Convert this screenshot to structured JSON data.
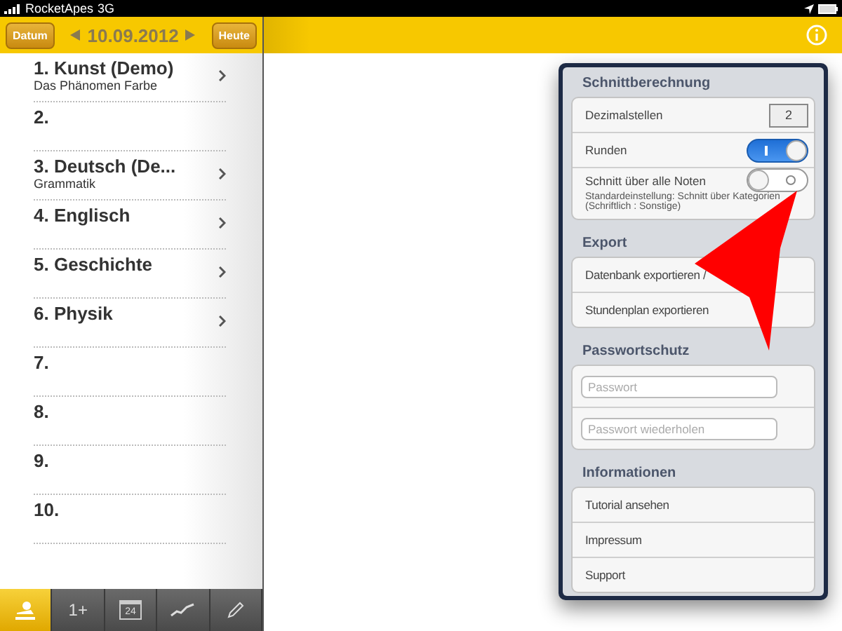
{
  "status_bar": {
    "carrier": "RocketApes",
    "network": "3G"
  },
  "left_header": {
    "left_button": "Datum",
    "date": "10.09.2012",
    "right_button": "Heute"
  },
  "lessons": [
    {
      "title": "1. Kunst (Demo)",
      "subtitle": "Das Phänomen Farbe",
      "has_detail": true
    },
    {
      "title": "2.",
      "has_detail": false
    },
    {
      "title": "3. Deutsch (De...",
      "subtitle": "Grammatik",
      "has_detail": true
    },
    {
      "title": "4. Englisch",
      "has_detail": true
    },
    {
      "title": "5. Geschichte",
      "has_detail": true
    },
    {
      "title": "6. Physik",
      "has_detail": true
    },
    {
      "title": "7.",
      "has_detail": false
    },
    {
      "title": "8.",
      "has_detail": false
    },
    {
      "title": "9.",
      "has_detail": false
    },
    {
      "title": "10.",
      "has_detail": false
    }
  ],
  "tab_bar": [
    {
      "kind": "person",
      "selected": true
    },
    {
      "kind": "ranking",
      "label": "1+",
      "selected": false
    },
    {
      "kind": "calendar",
      "label": "24",
      "selected": false
    },
    {
      "kind": "chart",
      "selected": false
    },
    {
      "kind": "pencil",
      "selected": false
    }
  ],
  "settings": {
    "sections": [
      {
        "title": "Schnittberechnung",
        "rows": [
          {
            "kind": "value",
            "label": "Dezimalstellen",
            "value": "2"
          },
          {
            "kind": "switch",
            "label": "Runden",
            "on": true
          },
          {
            "kind": "switch",
            "label": "Schnitt über alle Noten",
            "on": false,
            "note": "Standardeinstellung: Schnitt über Kategorien (Schriftlich : Sonstige)"
          }
        ]
      },
      {
        "title": "Export",
        "rows": [
          {
            "kind": "action",
            "label": "Datenbank exportieren /"
          },
          {
            "kind": "action",
            "label": "Stundenplan exportieren"
          }
        ]
      },
      {
        "title": "Passwortschutz",
        "rows": [
          {
            "kind": "input",
            "placeholder": "Passwort"
          },
          {
            "kind": "input",
            "placeholder": "Passwort wiederholen"
          }
        ]
      },
      {
        "title": "Informationen",
        "rows": [
          {
            "kind": "action",
            "label": "Tutorial ansehen"
          },
          {
            "kind": "action",
            "label": "Impressum"
          },
          {
            "kind": "action",
            "label": "Support"
          }
        ]
      }
    ]
  }
}
